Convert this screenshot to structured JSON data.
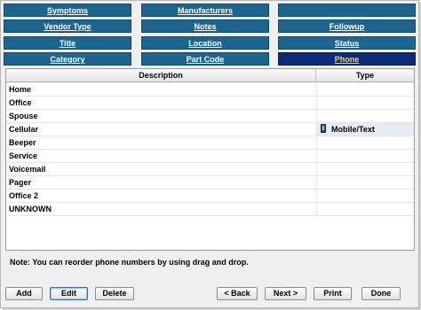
{
  "tabs": {
    "symptoms": "Symptoms",
    "manufacturers": "Manufacturers",
    "blank": "",
    "vendor_type": "Vendor Type",
    "notes": "Notes",
    "followup": "Followup",
    "title": "Title",
    "location": "Location",
    "status": "Status",
    "category": "Category",
    "part_code": "Part Code",
    "phone": "Phone"
  },
  "grid": {
    "columns": [
      "Description",
      "Type"
    ],
    "rows": [
      {
        "description": "Home",
        "type": ""
      },
      {
        "description": "Office",
        "type": ""
      },
      {
        "description": "Spouse",
        "type": ""
      },
      {
        "description": "Cellular",
        "type": "Mobile/Text",
        "type_icon": "mobile-phone-icon"
      },
      {
        "description": "Beeper",
        "type": ""
      },
      {
        "description": "Service",
        "type": ""
      },
      {
        "description": "Voicemail",
        "type": ""
      },
      {
        "description": "Pager",
        "type": ""
      },
      {
        "description": "Office 2",
        "type": ""
      },
      {
        "description": "UNKNOWN",
        "type": ""
      }
    ]
  },
  "note": "Note: You can reorder phone numbers by using drag and drop.",
  "buttons": {
    "add": "Add",
    "edit": "Edit",
    "delete": "Delete",
    "back": "< Back",
    "next": "Next >",
    "print": "Print",
    "done": "Done"
  },
  "colors": {
    "tab_bg": "#1b6691",
    "tab_active_bg": "#0a2a7a",
    "tab_active_text": "#ffd84a"
  }
}
